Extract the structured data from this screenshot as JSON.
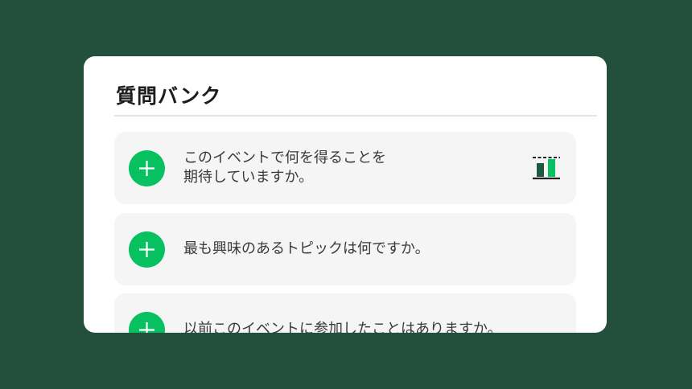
{
  "panel": {
    "title": "質問バンク"
  },
  "questions": [
    {
      "text": "このイベントで何を得ることを\n期待していますか。",
      "icon": "poll-chart-icon"
    },
    {
      "text": "最も興味のあるトピックは何ですか。"
    },
    {
      "text": "以前このイベントに参加したことはありますか。"
    }
  ],
  "colors": {
    "background": "#22503c",
    "card": "#ffffff",
    "item_background": "#f5f5f5",
    "accent_green": "#07c160",
    "text": "#3a3a3a"
  }
}
